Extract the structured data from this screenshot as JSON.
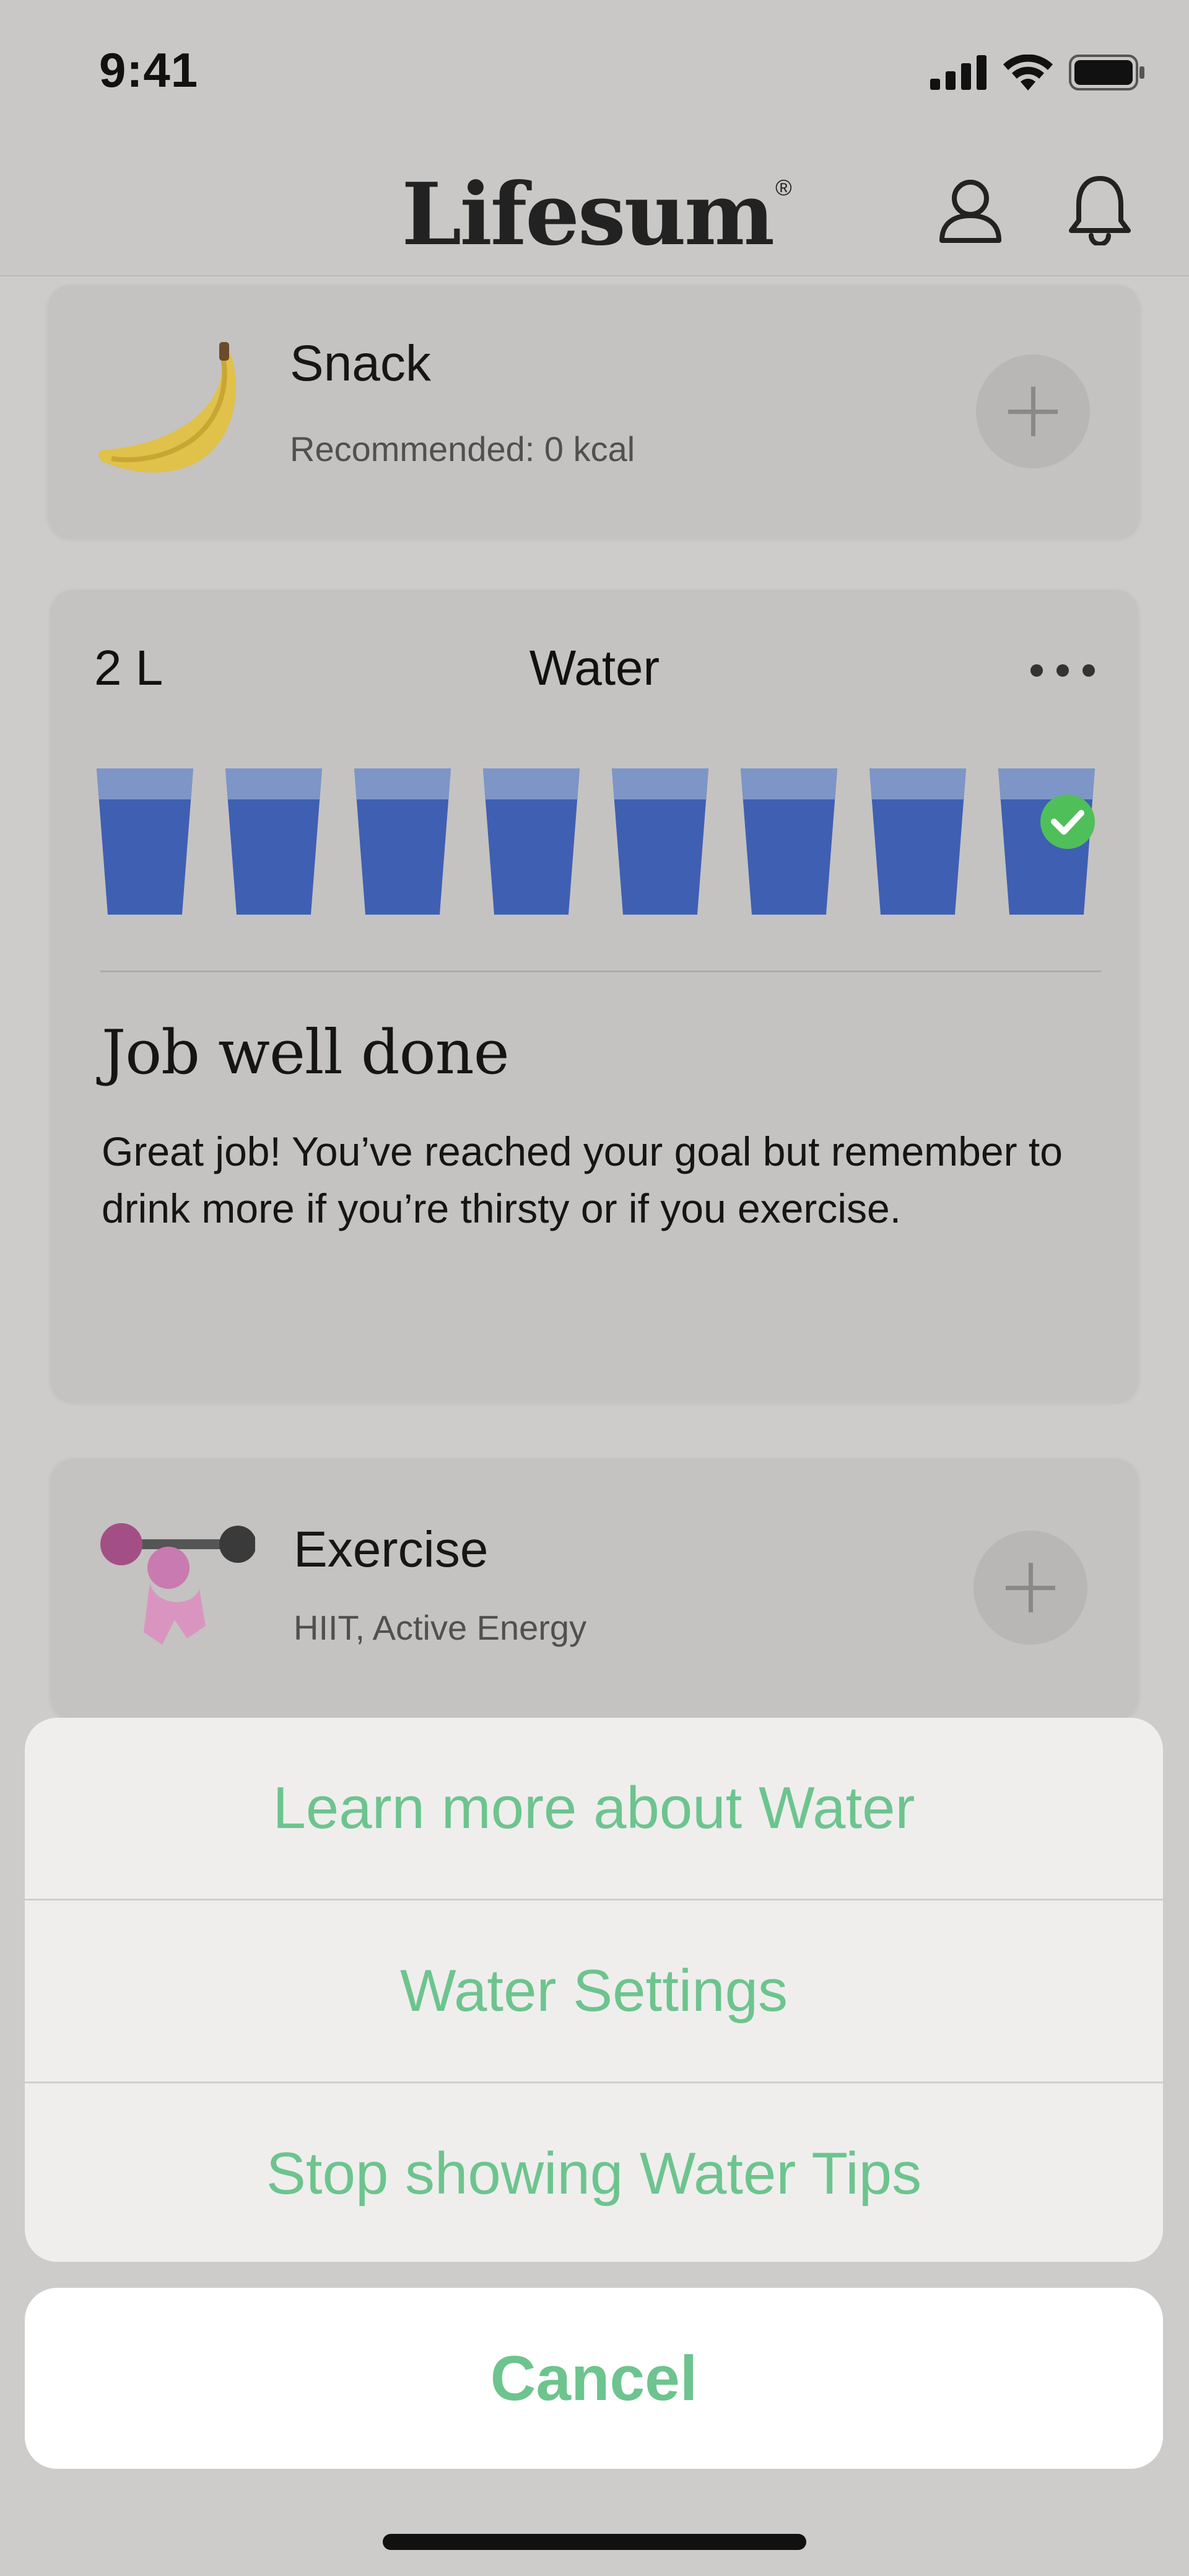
{
  "status_bar": {
    "time": "9:41"
  },
  "header": {
    "logo_text": "Lifesum",
    "logo_mark": "®"
  },
  "snack": {
    "title": "Snack",
    "subtitle": "Recommended: 0  kcal"
  },
  "water": {
    "goal": "2 L",
    "title": "Water",
    "glasses_filled": 8,
    "glasses_total": 8,
    "tip_title": "Job well done",
    "tip_body": "Great job! You’ve reached your goal but remember to drink more if you’re thirsty or if you exercise."
  },
  "exercise": {
    "title": "Exercise",
    "subtitle": "HIIT, Active Energy"
  },
  "action_sheet": {
    "items": [
      {
        "label": "Learn more about Water"
      },
      {
        "label": "Water Settings"
      },
      {
        "label": "Stop showing Water Tips"
      }
    ],
    "cancel_label": "Cancel"
  },
  "colors": {
    "accent": "#6dc48e",
    "check": "#4fbf5a",
    "water_blue": "#3f5fb3"
  }
}
